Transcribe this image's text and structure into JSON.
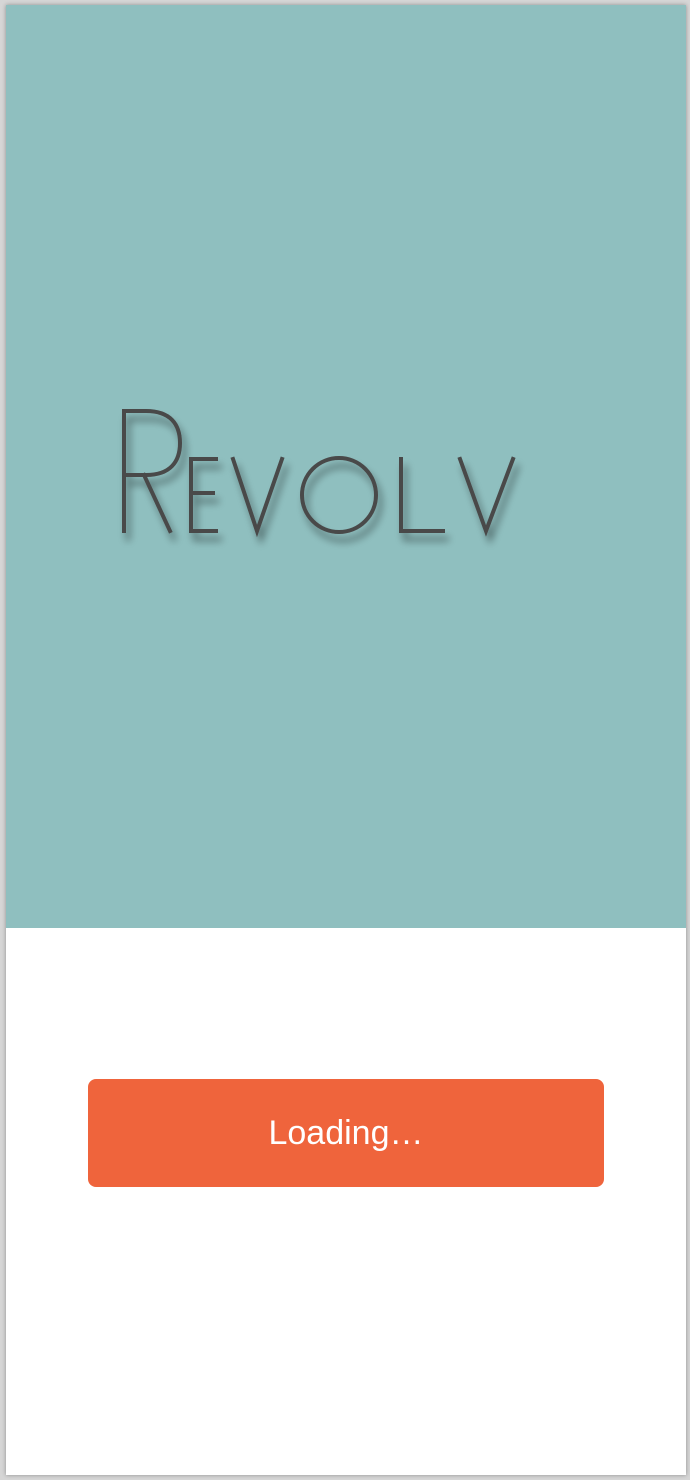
{
  "app": {
    "logo_text": "Revolv"
  },
  "loading": {
    "label": "Loading…"
  },
  "colors": {
    "hero_background": "#8fbfbf",
    "logo": "#484848",
    "button_background": "#ef643c",
    "button_text": "#ffffff",
    "page_background": "#ffffff"
  },
  "icons": {
    "logo": "revolv-wordmark-logo"
  }
}
